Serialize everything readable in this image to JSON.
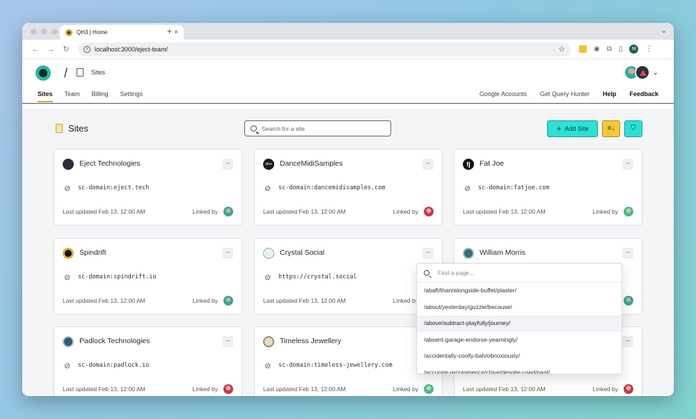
{
  "browser": {
    "tab_title": "QH3 | Home",
    "tab_close": "×",
    "new_tab": "+",
    "url": "localhost:3000/eject-team/",
    "profile_initial": "M"
  },
  "header": {
    "breadcrumb": "Sites"
  },
  "nav": {
    "left": [
      "Sites",
      "Team",
      "Billing",
      "Settings"
    ],
    "right": [
      "Google Accounts",
      "Get Query Hunter",
      "Help",
      "Feedback"
    ]
  },
  "page": {
    "title": "Sites",
    "search_placeholder": "Search for a site",
    "add_site_label": "Add Site",
    "add_site_icon": "+",
    "sort_icon_glyph": "≡↓",
    "filter_icon_glyph": "⛉"
  },
  "cards": [
    {
      "name": "Eject Technologies",
      "domain": "sc-domain:eject.tech",
      "updated": "Last updated Feb 13, 12:00 AM",
      "linked": "Linked by",
      "icon": "eject-logo-icon",
      "icon_text": ""
    },
    {
      "name": "DanceMidiSamples",
      "domain": "sc-domain:dancemidisamples.com",
      "updated": "Last updated Feb 13, 12:00 AM",
      "linked": "Linked by",
      "icon": "dms-logo-icon",
      "icon_text": "dms"
    },
    {
      "name": "Fat Joe",
      "domain": "sc-domain:fatjoe.com",
      "updated": "Last updated Feb 13, 12:00 AM",
      "linked": "Linked by",
      "icon": "fatjoe-logo-icon",
      "icon_text": "fj"
    },
    {
      "name": "Spindrift",
      "domain": "sc-domain:spindrift.io",
      "updated": "Last updated Feb 13, 12:00 AM",
      "linked": "Linked by",
      "icon": "spindrift-logo-icon",
      "icon_text": ""
    },
    {
      "name": "Crystal Social",
      "domain": "https://crystal.social",
      "updated": "Last updated Feb 13, 12:00 AM",
      "linked": "Linked by",
      "icon": "crystal-logo-icon",
      "icon_text": ""
    },
    {
      "name": "William Morris",
      "domain": "",
      "updated": "",
      "linked": "",
      "icon": "william-morris-logo-icon",
      "icon_text": ""
    },
    {
      "name": "Padlock Technologies",
      "domain": "sc-domain:padlock.io",
      "updated": "Last updated Feb 13, 12:00 AM",
      "linked": "Linked by",
      "icon": "padlock-logo-icon",
      "icon_text": ""
    },
    {
      "name": "Timeless Jewellery",
      "domain": "sc-domain:timeless-jewellery.com",
      "updated": "Last updated Feb 13, 12:00 AM",
      "linked": "Linked by",
      "icon": "timeless-logo-icon",
      "icon_text": ""
    },
    {
      "name": "",
      "domain": "",
      "updated": "Last updated Feb 13, 12:00 AM",
      "linked": "Linked by",
      "icon": "",
      "icon_text": ""
    }
  ],
  "card_menu_glyph": "···",
  "link_glyph": "⊖",
  "dropdown": {
    "placeholder": "Find a page...",
    "options": [
      "/abaft/than/alongside-buffet/plaster/",
      "/about/yesterday/guzzle/because/",
      "/above/subtract-playfully/journey/",
      "/absent-garage-endorse-yearningly/",
      "/accidentally-coolly-bah/obnoxiously/",
      "/accurate-recommence/chive/despite-used/past/"
    ],
    "highlighted_index": 2
  },
  "colors": {
    "accent_teal": "#2de0d3",
    "accent_yellow": "#f4c938",
    "tab_underline": "#d3a42f"
  }
}
